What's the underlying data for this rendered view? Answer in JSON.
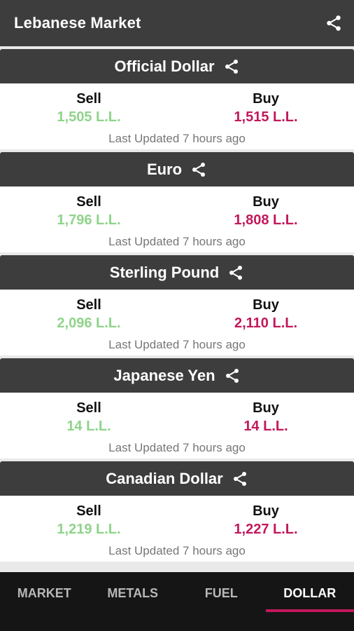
{
  "appbar": {
    "title": "Lebanese Market",
    "share_icon": "share-icon"
  },
  "colors": {
    "header_bg": "#3d3d3d",
    "sell": "#8fd48a",
    "buy": "#c2185b",
    "tab_indicator": "#c2185b"
  },
  "cards": [
    {
      "title": "Official Dollar",
      "sell_label": "Sell",
      "buy_label": "Buy",
      "sell": "1,505 L.L.",
      "buy": "1,515 L.L.",
      "updated": "Last Updated 7 hours ago"
    },
    {
      "title": "Euro",
      "sell_label": "Sell",
      "buy_label": "Buy",
      "sell": "1,796 L.L.",
      "buy": "1,808 L.L.",
      "updated": "Last Updated 7 hours ago"
    },
    {
      "title": "Sterling Pound",
      "sell_label": "Sell",
      "buy_label": "Buy",
      "sell": "2,096 L.L.",
      "buy": "2,110 L.L.",
      "updated": "Last Updated 7 hours ago"
    },
    {
      "title": "Japanese Yen",
      "sell_label": "Sell",
      "buy_label": "Buy",
      "sell": "14 L.L.",
      "buy": "14 L.L.",
      "updated": "Last Updated 7 hours ago"
    },
    {
      "title": "Canadian Dollar",
      "sell_label": "Sell",
      "buy_label": "Buy",
      "sell": "1,219 L.L.",
      "buy": "1,227 L.L.",
      "updated": "Last Updated 7 hours ago"
    }
  ],
  "tabs": [
    {
      "label": "MARKET",
      "active": false
    },
    {
      "label": "METALS",
      "active": false
    },
    {
      "label": "FUEL",
      "active": false
    },
    {
      "label": "DOLLAR",
      "active": true
    }
  ]
}
